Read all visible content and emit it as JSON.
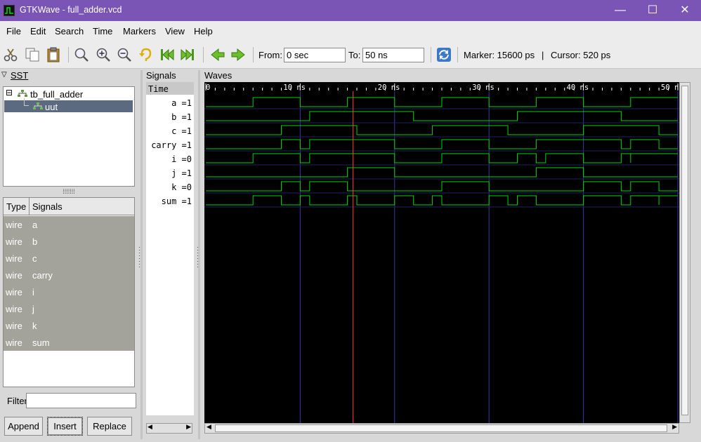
{
  "window": {
    "title": "GTKWave - full_adder.vcd",
    "minimize_glyph": "—",
    "maximize_glyph": "☐",
    "close_glyph": "✕"
  },
  "menu": [
    "File",
    "Edit",
    "Search",
    "Time",
    "Markers",
    "View",
    "Help"
  ],
  "toolbar": {
    "icons": [
      "cut-icon",
      "copy-icon",
      "paste-icon",
      "zoom-fit-icon",
      "zoom-in-icon",
      "zoom-out-icon",
      "undo-icon",
      "go-to-start-icon",
      "go-to-end-icon",
      "step-back-icon",
      "step-forward-icon",
      "reload-icon"
    ],
    "from_label": "From:",
    "from_value": "0 sec",
    "to_label": "To:",
    "to_value": "50 ns",
    "marker_text": "Marker: 15600 ps",
    "separator": "|",
    "cursor_text": "Cursor: 520 ps"
  },
  "sst": {
    "header": "SST",
    "tree": [
      {
        "label": "tb_full_adder",
        "expander": "⊟"
      },
      {
        "label": "uut",
        "selected": true
      }
    ],
    "splitter_glyph": "⁞⁞⁞⁞⁞⁞⁞"
  },
  "signal_table": {
    "col_type": "Type",
    "col_signals": "Signals",
    "rows": [
      {
        "type": "wire",
        "name": "a"
      },
      {
        "type": "wire",
        "name": "b"
      },
      {
        "type": "wire",
        "name": "c"
      },
      {
        "type": "wire",
        "name": "carry"
      },
      {
        "type": "wire",
        "name": "i"
      },
      {
        "type": "wire",
        "name": "j"
      },
      {
        "type": "wire",
        "name": "k"
      },
      {
        "type": "wire",
        "name": "sum"
      }
    ]
  },
  "filter": {
    "label": "Filter:",
    "value": ""
  },
  "buttons": {
    "append": "Append",
    "insert": "Insert",
    "replace": "Replace"
  },
  "signals_pane": {
    "title": "Signals",
    "time_label": "Time",
    "items": [
      "a =1",
      "b =1",
      "c =1",
      "carry =1",
      "i =0",
      "j =1",
      "k =0",
      "sum =1"
    ]
  },
  "waves_pane": {
    "title": "Waves",
    "time_end_ns": 50,
    "marker_ns": 15.6,
    "tick_labels": [
      "0",
      "10 ns",
      "20 ns",
      "30 ns",
      "40 ns",
      "50 ns"
    ],
    "tick_values_ns": [
      0,
      10,
      20,
      30,
      40,
      50
    ],
    "colors": {
      "background": "#000000",
      "wave": "#00d400",
      "grid": "#3a3aa0",
      "marker": "#ff4040",
      "text": "#ffffff"
    },
    "traces": [
      {
        "name": "a",
        "transitions_ns": [
          [
            0,
            0
          ],
          [
            5,
            1
          ],
          [
            10,
            0
          ],
          [
            15,
            1
          ],
          [
            20,
            0
          ],
          [
            25,
            1
          ],
          [
            30,
            0
          ],
          [
            35,
            1
          ],
          [
            40,
            0
          ],
          [
            45,
            1
          ]
        ]
      },
      {
        "name": "b",
        "transitions_ns": [
          [
            0,
            0
          ],
          [
            11,
            1
          ],
          [
            22,
            0
          ],
          [
            33,
            1
          ],
          [
            44,
            0
          ]
        ]
      },
      {
        "name": "c",
        "transitions_ns": [
          [
            0,
            0
          ],
          [
            8,
            1
          ],
          [
            16,
            0
          ],
          [
            24,
            1
          ],
          [
            32,
            0
          ],
          [
            40,
            1
          ],
          [
            48,
            0
          ]
        ]
      },
      {
        "name": "carry",
        "transitions_ns": [
          [
            0,
            0
          ],
          [
            8,
            1
          ],
          [
            10,
            0
          ],
          [
            11,
            1
          ],
          [
            20,
            0
          ],
          [
            25,
            1
          ],
          [
            30,
            0
          ],
          [
            35,
            1
          ],
          [
            44,
            0
          ],
          [
            45,
            1
          ],
          [
            48,
            0
          ]
        ]
      },
      {
        "name": "i",
        "transitions_ns": [
          [
            0,
            0
          ],
          [
            5,
            1
          ],
          [
            10,
            0
          ],
          [
            11,
            1
          ],
          [
            20,
            0
          ],
          [
            25,
            1
          ],
          [
            30,
            0
          ],
          [
            33,
            1
          ],
          [
            35,
            0
          ],
          [
            36,
            1
          ],
          [
            40,
            0
          ],
          [
            44,
            1
          ],
          [
            45,
            0
          ],
          [
            45,
            1
          ]
        ]
      },
      {
        "name": "j",
        "transitions_ns": [
          [
            0,
            0
          ],
          [
            15,
            1
          ],
          [
            20,
            0
          ],
          [
            35,
            1
          ],
          [
            40,
            0
          ]
        ]
      },
      {
        "name": "k",
        "transitions_ns": [
          [
            0,
            0
          ],
          [
            8,
            1
          ],
          [
            10,
            0
          ],
          [
            11,
            1
          ],
          [
            15,
            0
          ],
          [
            25,
            1
          ],
          [
            30,
            0
          ],
          [
            40,
            1
          ],
          [
            44,
            0
          ],
          [
            45,
            1
          ],
          [
            48,
            0
          ]
        ]
      },
      {
        "name": "sum",
        "transitions_ns": [
          [
            0,
            0
          ],
          [
            5,
            1
          ],
          [
            8,
            0
          ],
          [
            10,
            1
          ],
          [
            11,
            0
          ],
          [
            15,
            1
          ],
          [
            16,
            0
          ],
          [
            20,
            1
          ],
          [
            22,
            0
          ],
          [
            24,
            1
          ],
          [
            25,
            0
          ],
          [
            30,
            1
          ],
          [
            32,
            0
          ],
          [
            33,
            1
          ],
          [
            35,
            0
          ],
          [
            40,
            1
          ],
          [
            44,
            0
          ],
          [
            45,
            1
          ],
          [
            48,
            0
          ],
          [
            48,
            1
          ]
        ]
      }
    ]
  }
}
